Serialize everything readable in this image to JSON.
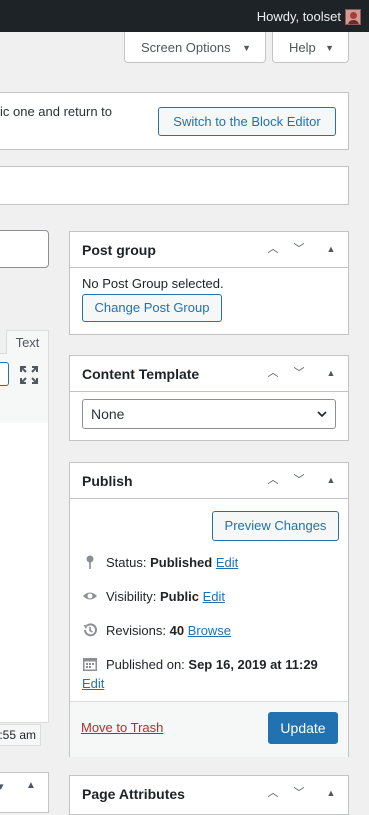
{
  "adminbar": {
    "greeting": "Howdy, toolset"
  },
  "screen_meta": {
    "screen_options": "Screen Options",
    "help": "Help"
  },
  "notice": {
    "text": "ic one and return to",
    "switch_button": "Switch to the Block Editor"
  },
  "editor": {
    "text_tab": "Text",
    "time_fragment": ":55 am"
  },
  "post_group": {
    "title": "Post group",
    "status_text": "No Post Group selected.",
    "change_button": "Change Post Group"
  },
  "content_template": {
    "title": "Content Template",
    "selected": "None"
  },
  "publish": {
    "title": "Publish",
    "preview_button": "Preview Changes",
    "status_label": "Status:",
    "status_value": "Published",
    "visibility_label": "Visibility:",
    "visibility_value": "Public",
    "revisions_label": "Revisions:",
    "revisions_value": "40",
    "published_on_label": "Published on:",
    "published_on_value": "Sep 16, 2019 at 11:29",
    "edit": "Edit",
    "browse": "Browse",
    "trash": "Move to Trash",
    "update": "Update"
  },
  "page_attributes": {
    "title": "Page Attributes"
  },
  "colors": {
    "primary": "#2271b1",
    "adminbar": "#1d2327",
    "danger": "#b32d2e"
  }
}
